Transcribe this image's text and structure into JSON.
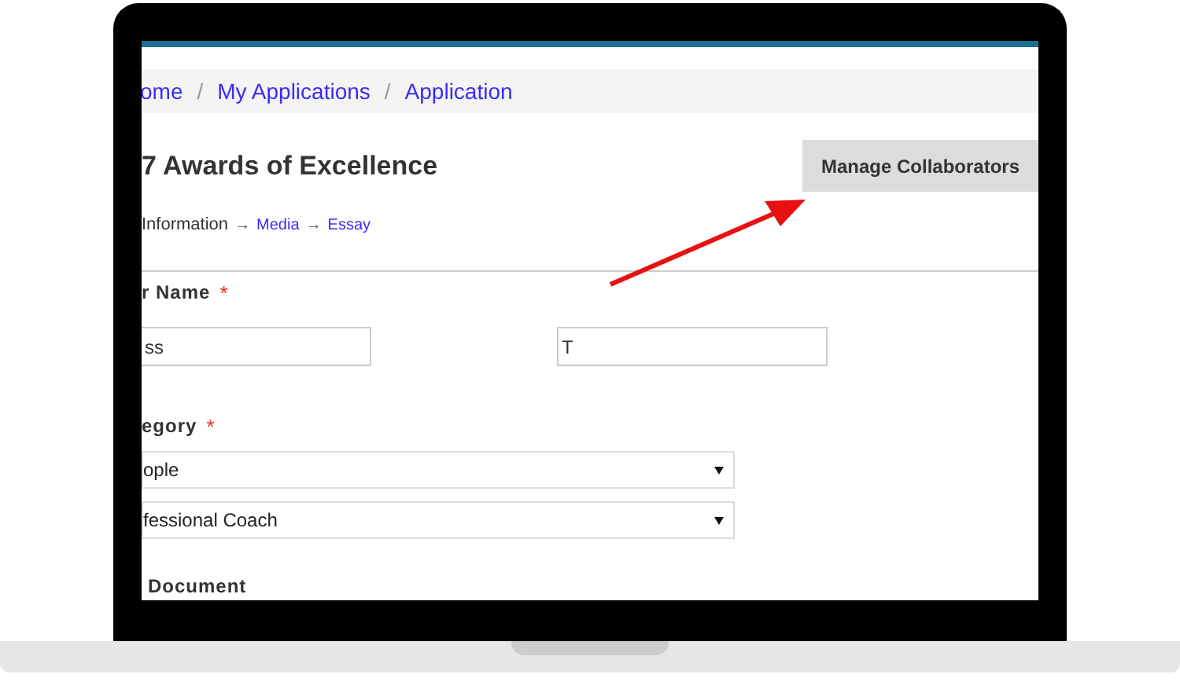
{
  "breadcrumb": [
    {
      "label": "ome"
    },
    {
      "label": "My Applications"
    },
    {
      "label": "Application"
    }
  ],
  "breadcrumb_separator": "/",
  "step_arrow": "→",
  "title": "7 Awards of Excellence",
  "manage_button": "Manage Collaborators",
  "steps": [
    {
      "label": "Information",
      "kind": "current"
    },
    {
      "label": "Media",
      "kind": "link"
    },
    {
      "label": "Essay",
      "kind": "link"
    }
  ],
  "name_field": {
    "label": "r Name",
    "required_mark": "*",
    "values": [
      "ss",
      "T"
    ]
  },
  "category_field": {
    "label": "egory",
    "required_mark": "*",
    "selects": [
      "ople",
      "fessional Coach"
    ]
  },
  "document_label": "Document"
}
